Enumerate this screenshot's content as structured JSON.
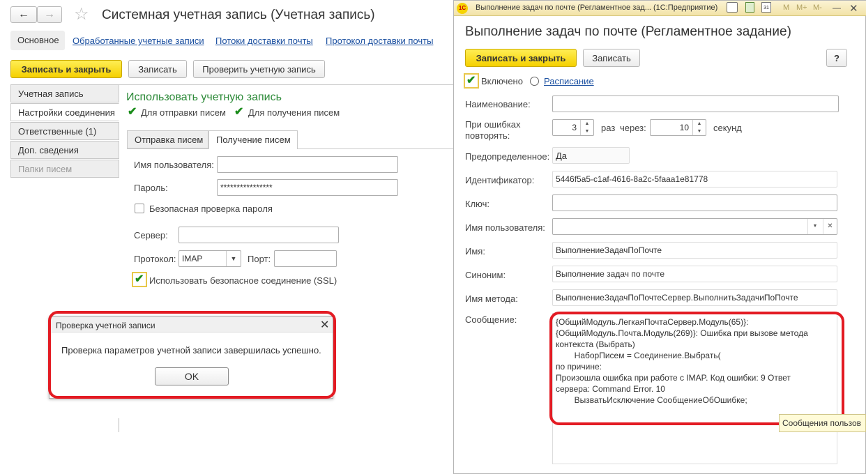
{
  "left": {
    "title": "Системная учетная запись (Учетная запись)",
    "nav_tabs": [
      "Основное",
      "Обработанные учетные записи",
      "Потоки доставки почты",
      "Протокол доставки почты"
    ],
    "toolbar": {
      "save_close": "Записать и закрыть",
      "save": "Записать",
      "check": "Проверить учетную запись"
    },
    "side_tabs": [
      "Учетная запись",
      "Настройки соединения",
      "Ответственные (1)",
      "Доп. сведения",
      "Папки писем"
    ],
    "use_account": "Использовать учетную запись",
    "for_sending": "Для отправки писем",
    "for_receiving": "Для получения писем",
    "sub_tabs": [
      "Отправка писем",
      "Получение писем"
    ],
    "username_label": "Имя пользователя:",
    "password_label": "Пароль:",
    "password_value": "****************",
    "secure_password": "Безопасная проверка пароля",
    "server_label": "Сервер:",
    "protocol_label": "Протокол:",
    "protocol_value": "IMAP",
    "port_label": "Порт:",
    "ssl_label": "Использовать безопасное соединение (SSL)"
  },
  "dialog": {
    "title": "Проверка учетной записи",
    "message": "Проверка параметров учетной записи завершилась успешно.",
    "ok": "OK"
  },
  "right": {
    "window_title": "Выполнение задач по почте (Регламентное зад... (1С:Предприятие)",
    "app_badge": "1С",
    "title_buttons": [
      "M",
      "M+",
      "M-"
    ],
    "heading": "Выполнение задач по почте (Регламентное задание)",
    "save_close": "Записать и закрыть",
    "save": "Записать",
    "help": "?",
    "enabled": "Включено",
    "schedule": "Расписание",
    "name_label": "Наименование:",
    "retry_label": "При ошибках повторять:",
    "retry_count": "3",
    "times_label": "раз",
    "after_label": "через:",
    "retry_interval": "10",
    "seconds_label": "секунд",
    "predefined_label": "Предопределенное:",
    "predefined_value": "Да",
    "id_label": "Идентификатор:",
    "id_value": "5446f5a5-c1af-4616-8a2c-5faaa1e81778",
    "key_label": "Ключ:",
    "user_label": "Имя пользователя:",
    "name2_label": "Имя:",
    "name2_value": "ВыполнениеЗадачПоПочте",
    "synonym_label": "Синоним:",
    "synonym_value": "Выполнение задач по почте",
    "method_label": "Имя метода:",
    "method_value": "ВыполнениеЗадачПоПочтеСервер.ВыполнитьЗадачиПоПочте",
    "message_label": "Сообщение:",
    "message_lines": [
      "{ОбщийМодуль.ЛегкаяПочтаСервер.Модуль(65)}:",
      "{ОбщийМодуль.Почта.Модуль(269)}: Ошибка при вызове метода",
      "контекста (Выбрать)",
      "        НаборПисем = Соединение.Выбрать(",
      "по причине:",
      "Произошла ошибка при работе с IMAP. Код ошибки: 9 Ответ",
      "сервера: Command Error. 10",
      "        ВызватьИсключение СообщениеОбОшибке;"
    ],
    "tooltip": "Сообщения пользов"
  }
}
